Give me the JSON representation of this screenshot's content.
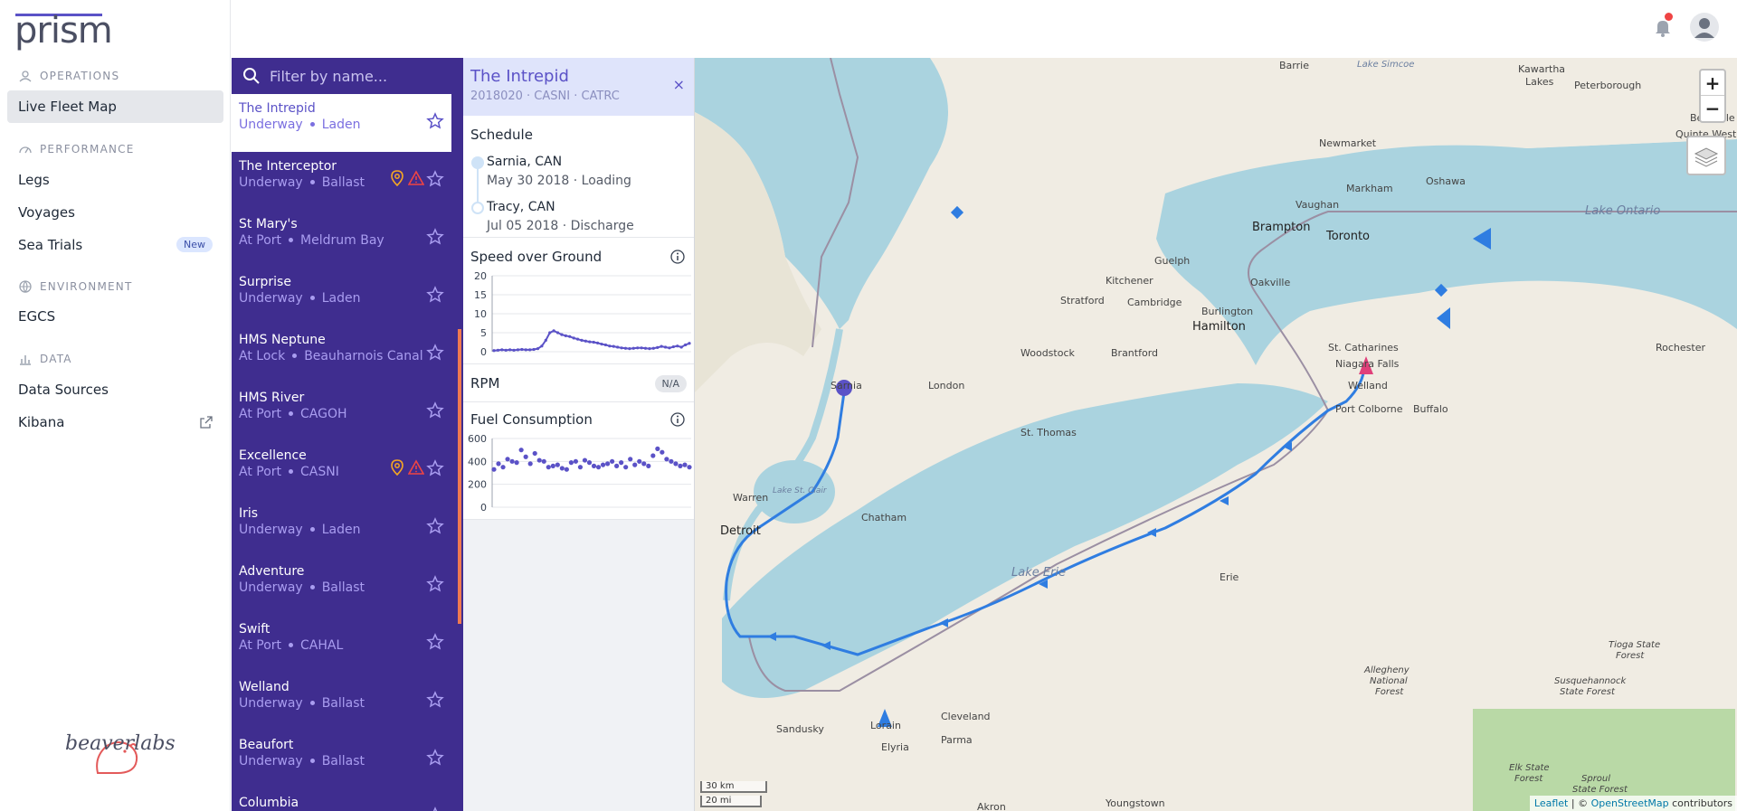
{
  "app": {
    "logo": "prism",
    "brand": "beaverlabs"
  },
  "nav": {
    "sections": [
      {
        "label": "OPERATIONS",
        "items": [
          {
            "label": "Live Fleet Map",
            "active": true
          }
        ]
      },
      {
        "label": "PERFORMANCE",
        "items": [
          {
            "label": "Legs"
          },
          {
            "label": "Voyages"
          },
          {
            "label": "Sea Trials",
            "badge": "New"
          }
        ]
      },
      {
        "label": "ENVIRONMENT",
        "items": [
          {
            "label": "EGCS"
          }
        ]
      },
      {
        "label": "DATA",
        "items": [
          {
            "label": "Data Sources"
          },
          {
            "label": "Kibana",
            "external": true
          }
        ]
      }
    ]
  },
  "search": {
    "placeholder": "Filter by name..."
  },
  "vessels": [
    {
      "name": "The Intrepid",
      "status": "Underway",
      "detail": "Laden",
      "selected": true
    },
    {
      "name": "The Interceptor",
      "status": "Underway",
      "detail": "Ballast",
      "alerts": true
    },
    {
      "name": "St Mary's",
      "status": "At Port",
      "detail": "Meldrum Bay"
    },
    {
      "name": "Surprise",
      "status": "Underway",
      "detail": "Laden"
    },
    {
      "name": "HMS Neptune",
      "status": "At Lock",
      "detail": "Beauharnois Canal"
    },
    {
      "name": "HMS River",
      "status": "At Port",
      "detail": "CAGOH"
    },
    {
      "name": "Excellence",
      "status": "At Port",
      "detail": "CASNI",
      "alerts": true
    },
    {
      "name": "Iris",
      "status": "Underway",
      "detail": "Laden"
    },
    {
      "name": "Adventure",
      "status": "Underway",
      "detail": "Ballast"
    },
    {
      "name": "Swift",
      "status": "At Port",
      "detail": "CAHAL"
    },
    {
      "name": "Welland",
      "status": "Underway",
      "detail": "Ballast"
    },
    {
      "name": "Beaufort",
      "status": "Underway",
      "detail": "Ballast"
    },
    {
      "name": "Columbia",
      "status": "",
      "detail": ""
    }
  ],
  "details": {
    "title": "The Intrepid",
    "subtitle": "2018020 · CASNI · CATRC",
    "close": "×",
    "schedule": {
      "title": "Schedule",
      "stops": [
        {
          "place": "Sarnia, CAN",
          "date": "May 30 2018",
          "action": "Loading"
        },
        {
          "place": "Tracy, CAN",
          "date": "Jul 05 2018",
          "action": "Discharge"
        }
      ]
    },
    "sog_title": "Speed over Ground",
    "rpm_title": "RPM",
    "rpm_value": "N/A",
    "fuel_title": "Fuel Consumption"
  },
  "chart_data": [
    {
      "type": "line",
      "title": "Speed over Ground",
      "ylim": [
        0,
        20
      ],
      "yticks": [
        0,
        5,
        10,
        15,
        20
      ],
      "values": [
        0.3,
        0.4,
        0.5,
        0.4,
        0.5,
        0.4,
        0.5,
        0.6,
        0.5,
        0.5,
        0.6,
        0.8,
        1.5,
        3.0,
        5.0,
        5.5,
        5.0,
        4.5,
        4.2,
        4.0,
        3.6,
        3.3,
        3.0,
        2.8,
        2.6,
        2.5,
        2.3,
        2.0,
        1.8,
        1.5,
        1.4,
        1.2,
        1.0,
        0.9,
        0.8,
        0.9,
        1.0,
        1.0,
        0.9,
        0.8,
        0.9,
        1.1,
        1.4,
        1.2,
        1.0,
        1.3,
        1.5,
        1.2,
        1.8,
        2.2
      ]
    },
    {
      "type": "scatter",
      "title": "Fuel Consumption",
      "ylim": [
        0,
        600
      ],
      "yticks": [
        0,
        200,
        400,
        600
      ],
      "values": [
        330,
        380,
        350,
        420,
        400,
        390,
        500,
        440,
        380,
        470,
        410,
        400,
        350,
        360,
        370,
        340,
        330,
        390,
        400,
        350,
        410,
        390,
        360,
        350,
        370,
        380,
        400,
        360,
        390,
        350,
        420,
        370,
        400,
        380,
        360,
        450,
        510,
        480,
        420,
        400,
        380,
        360,
        370,
        350
      ]
    }
  ],
  "map": {
    "zoom_in": "+",
    "zoom_out": "−",
    "scale_km": "30 km",
    "scale_mi": "20 mi",
    "attribution_leaflet": "Leaflet",
    "attribution_sep": " | © ",
    "attribution_osm": "OpenStreetMap",
    "attribution_tail": " contributors",
    "labels": {
      "barrie": "Barrie",
      "lake_simcoe": "Lake Simcoe",
      "kawartha": "Kawartha",
      "lakes": "Lakes",
      "peterborough": "Peterborough",
      "belleville": "Belleville",
      "quinte_west": "Quinte West",
      "newmarket": "Newmarket",
      "markham": "Markham",
      "oshawa": "Oshawa",
      "vaughan": "Vaughan",
      "brampton": "Brampton",
      "toronto": "Toronto",
      "lake_ontario": "Lake Ontario",
      "guelph": "Guelph",
      "kitchener": "Kitchener",
      "stratford": "Stratford",
      "cambridge": "Cambridge",
      "oakville": "Oakville",
      "burlington": "Burlington",
      "hamilton": "Hamilton",
      "woodstock": "Woodstock",
      "brantford": "Brantford",
      "st_catharines": "St. Catharines",
      "niagara_falls": "Niagara Falls",
      "rochester": "Rochester",
      "london": "London",
      "welland": "Welland",
      "port_colborne": "Port Colborne",
      "buffalo": "Buffalo",
      "st_thomas": "St. Thomas",
      "lake_st_clair": "Lake St. Clair",
      "warren": "Warren",
      "detroit": "Detroit",
      "chatham": "Chatham",
      "lake_erie": "Lake Erie",
      "erie": "Erie",
      "sandusky": "Sandusky",
      "lorain": "Lorain",
      "elyria": "Elyria",
      "cleveland": "Cleveland",
      "parma": "Parma",
      "youngstown": "Youngstown",
      "akron": "Akron",
      "sarnia": "Sarnia",
      "allegheny": "Allegheny",
      "national": "National",
      "forest": "Forest",
      "tioga": "Tioga State",
      "tioga_forest": "Forest",
      "susquehannock": "Susquehannock",
      "state_forest": "State Forest",
      "elk_state": "Elk State",
      "elk_forest": "Forest",
      "sproul": "Sproul",
      "sproul_forest": "State Forest"
    }
  },
  "colors": {
    "accent": "#5b52c7",
    "sidebar": "#3f2d8f",
    "route": "#2f7de1",
    "water": "#aad3df",
    "land": "#f0ece3"
  }
}
